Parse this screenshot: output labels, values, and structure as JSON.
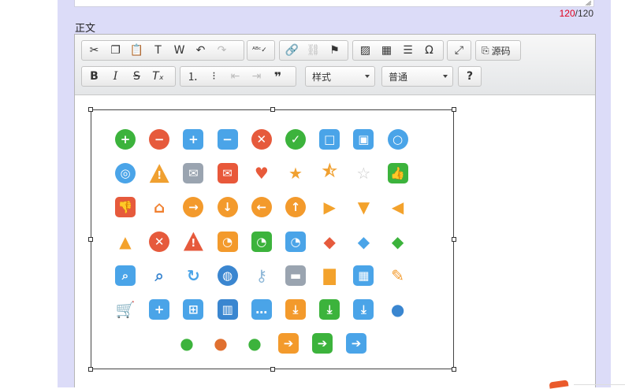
{
  "counter": {
    "current": "120",
    "separator": "/",
    "max": "120"
  },
  "field_label": "正文",
  "toolbar": {
    "source_label": "源码",
    "style_combo": "样式",
    "format_combo": "普通",
    "help_label": "?"
  },
  "icons": [
    {
      "name": "add-circle-icon",
      "color": "#3cb33c",
      "glyph": "+",
      "shape": "circle"
    },
    {
      "name": "remove-circle-icon",
      "color": "#e65a3c",
      "glyph": "−",
      "shape": "circle"
    },
    {
      "name": "add-square-icon",
      "color": "#4aa4e8",
      "glyph": "+",
      "shape": "square"
    },
    {
      "name": "minus-square-icon",
      "color": "#4aa4e8",
      "glyph": "−",
      "shape": "square"
    },
    {
      "name": "close-circle-icon",
      "color": "#e65a3c",
      "glyph": "✕",
      "shape": "circle"
    },
    {
      "name": "check-circle-icon",
      "color": "#3cb33c",
      "glyph": "✓",
      "shape": "circle"
    },
    {
      "name": "stop-square-icon",
      "color": "#4aa4e8",
      "glyph": "□",
      "shape": "square"
    },
    {
      "name": "record-square-icon",
      "color": "#4aa4e8",
      "glyph": "▣",
      "shape": "square"
    },
    {
      "name": "ring-icon",
      "color": "#4aa4e8",
      "glyph": "○",
      "shape": "circle"
    },
    {
      "name": "target-icon",
      "color": "#4aa4e8",
      "glyph": "◎",
      "shape": "circle"
    },
    {
      "name": "warning-icon",
      "color": "#f0a030",
      "glyph": "!",
      "shape": "triangle"
    },
    {
      "name": "mail-gray-icon",
      "color": "#9aa4b0",
      "glyph": "✉",
      "shape": "square"
    },
    {
      "name": "mail-red-icon",
      "color": "#e8583a",
      "glyph": "✉",
      "shape": "square"
    },
    {
      "name": "heart-icon",
      "color": "#e85a3a",
      "glyph": "♥",
      "shape": "plain"
    },
    {
      "name": "star-icon",
      "color": "#f0a030",
      "glyph": "★",
      "shape": "plain"
    },
    {
      "name": "star-half-icon",
      "color": "#f0a030",
      "glyph": "⯪",
      "shape": "plain"
    },
    {
      "name": "star-empty-icon",
      "color": "#cccccc",
      "glyph": "☆",
      "shape": "plain"
    },
    {
      "name": "thumbs-up-icon",
      "color": "#3cb33c",
      "glyph": "👍",
      "shape": "square"
    },
    {
      "name": "thumbs-down-icon",
      "color": "#e65a3c",
      "glyph": "👎",
      "shape": "square"
    },
    {
      "name": "home-icon",
      "color": "#f08030",
      "glyph": "⌂",
      "shape": "plain"
    },
    {
      "name": "arrow-right-circle-icon",
      "color": "#f39a2c",
      "glyph": "→",
      "shape": "circle"
    },
    {
      "name": "arrow-down-circle-icon",
      "color": "#f39a2c",
      "glyph": "↓",
      "shape": "circle"
    },
    {
      "name": "arrow-left-circle-icon",
      "color": "#f39a2c",
      "glyph": "←",
      "shape": "circle"
    },
    {
      "name": "arrow-up-circle-icon",
      "color": "#f39a2c",
      "glyph": "↑",
      "shape": "circle"
    },
    {
      "name": "play-right-icon",
      "color": "#f3a22c",
      "glyph": "▶",
      "shape": "plain"
    },
    {
      "name": "caret-down-icon",
      "color": "#f3a22c",
      "glyph": "▼",
      "shape": "plain"
    },
    {
      "name": "caret-left-icon",
      "color": "#f3a22c",
      "glyph": "◀",
      "shape": "plain"
    },
    {
      "name": "caret-up-icon",
      "color": "#f3a22c",
      "glyph": "▲",
      "shape": "plain"
    },
    {
      "name": "close-octagon-icon",
      "color": "#e65a3c",
      "glyph": "✕",
      "shape": "circle"
    },
    {
      "name": "alert-triangle-icon",
      "color": "#e65a3c",
      "glyph": "!",
      "shape": "triangle"
    },
    {
      "name": "rss-orange-icon",
      "color": "#f39a2c",
      "glyph": "◔",
      "shape": "square"
    },
    {
      "name": "rss-green-icon",
      "color": "#3cb33c",
      "glyph": "◔",
      "shape": "square"
    },
    {
      "name": "rss-blue-icon",
      "color": "#4aa4e8",
      "glyph": "◔",
      "shape": "square"
    },
    {
      "name": "tag-red-icon",
      "color": "#e65a3c",
      "glyph": "◆",
      "shape": "plain"
    },
    {
      "name": "tag-blue-icon",
      "color": "#4aa4e8",
      "glyph": "◆",
      "shape": "plain"
    },
    {
      "name": "tag-green-icon",
      "color": "#3cb33c",
      "glyph": "◆",
      "shape": "plain"
    },
    {
      "name": "search-square-icon",
      "color": "#4aa4e8",
      "glyph": "⌕",
      "shape": "square"
    },
    {
      "name": "search-icon",
      "color": "#3a86d0",
      "glyph": "⌕",
      "shape": "plain"
    },
    {
      "name": "refresh-icon",
      "color": "#4aa4e8",
      "glyph": "↻",
      "shape": "plain"
    },
    {
      "name": "globe-icon",
      "color": "#3a86d0",
      "glyph": "◍",
      "shape": "circle"
    },
    {
      "name": "key-icon",
      "color": "#8fb8d8",
      "glyph": "⚷",
      "shape": "plain"
    },
    {
      "name": "lock-icon",
      "color": "#9aa4b0",
      "glyph": "▬",
      "shape": "square"
    },
    {
      "name": "folder-icon",
      "color": "#f3a22c",
      "glyph": "▇",
      "shape": "plain"
    },
    {
      "name": "calendar-icon",
      "color": "#4aa4e8",
      "glyph": "▦",
      "shape": "square"
    },
    {
      "name": "pencil-icon",
      "color": "#f39a2c",
      "glyph": "✎",
      "shape": "plain"
    },
    {
      "name": "cart-icon",
      "color": "#4aa4e8",
      "glyph": "🛒",
      "shape": "plain"
    },
    {
      "name": "cart-add-icon",
      "color": "#4aa4e8",
      "glyph": "+",
      "shape": "square"
    },
    {
      "name": "cart-square-icon",
      "color": "#4aa4e8",
      "glyph": "⊞",
      "shape": "square"
    },
    {
      "name": "trash-icon",
      "color": "#3a86d0",
      "glyph": "▥",
      "shape": "square"
    },
    {
      "name": "chat-bubble-icon",
      "color": "#4aa4e8",
      "glyph": "…",
      "shape": "square"
    },
    {
      "name": "download-orange-icon",
      "color": "#f39a2c",
      "glyph": "⤓",
      "shape": "square"
    },
    {
      "name": "download-green-icon",
      "color": "#3cb33c",
      "glyph": "⤓",
      "shape": "square"
    },
    {
      "name": "download-blue-icon",
      "color": "#4aa4e8",
      "glyph": "⤓",
      "shape": "square"
    },
    {
      "name": "user-blue-icon",
      "color": "#3a86d0",
      "glyph": "●",
      "shape": "plain"
    },
    {
      "name": "user-green-icon",
      "color": "#3cb33c",
      "glyph": "●",
      "shape": "plain"
    },
    {
      "name": "user-female-icon",
      "color": "#e07030",
      "glyph": "●",
      "shape": "plain"
    },
    {
      "name": "users-group-icon",
      "color": "#3cb33c",
      "glyph": "●",
      "shape": "plain"
    },
    {
      "name": "arrow-right-orange-icon",
      "color": "#f39a2c",
      "glyph": "➔",
      "shape": "square"
    },
    {
      "name": "arrow-right-green-icon",
      "color": "#3cb33c",
      "glyph": "➔",
      "shape": "square"
    },
    {
      "name": "arrow-right-blue-icon",
      "color": "#4aa4e8",
      "glyph": "➔",
      "shape": "square"
    }
  ]
}
